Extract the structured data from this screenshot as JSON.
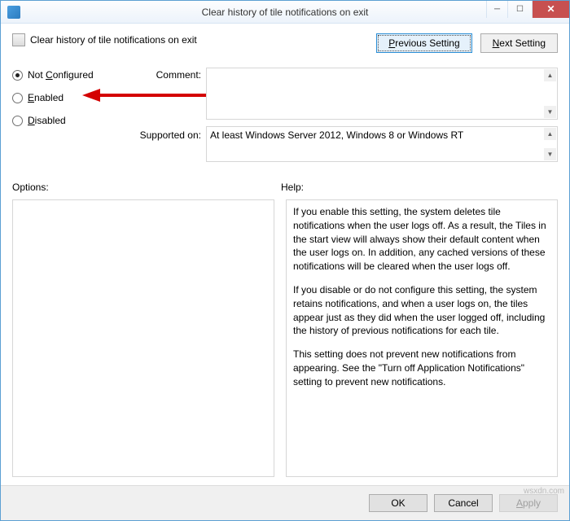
{
  "window": {
    "title": "Clear history of tile notifications on exit"
  },
  "header": {
    "title": "Clear history of tile notifications on exit",
    "previous_button": "Previous Setting",
    "next_button": "Next Setting",
    "previous_underline": "P",
    "next_underline": "N"
  },
  "radios": {
    "not_configured": "Not Configured",
    "enabled": "Enabled",
    "disabled": "Disabled",
    "nc_u": "C",
    "en_u": "E",
    "dis_u": "D",
    "selected": "not_configured"
  },
  "fields": {
    "comment_label": "Comment:",
    "comment_value": "",
    "supported_label": "Supported on:",
    "supported_value": "At least Windows Server 2012, Windows 8 or Windows RT"
  },
  "labels": {
    "options": "Options:",
    "help": "Help:"
  },
  "help": {
    "p1": "If you enable this setting, the system deletes tile notifications when the user logs off. As a result, the Tiles in the start view will always show their default content when the user logs on. In addition, any cached versions of these notifications will be cleared when the user logs off.",
    "p2": "If you disable or do not configure this setting, the system retains notifications, and when a user logs on, the tiles appear just as they did when the user logged off, including the history of previous notifications for each tile.",
    "p3": "This setting does not prevent new notifications from appearing. See the \"Turn off Application Notifications\" setting to prevent new notifications."
  },
  "footer": {
    "ok": "OK",
    "cancel": "Cancel",
    "apply": "Apply",
    "apply_u": "A"
  },
  "watermark": "wsxdn.com"
}
